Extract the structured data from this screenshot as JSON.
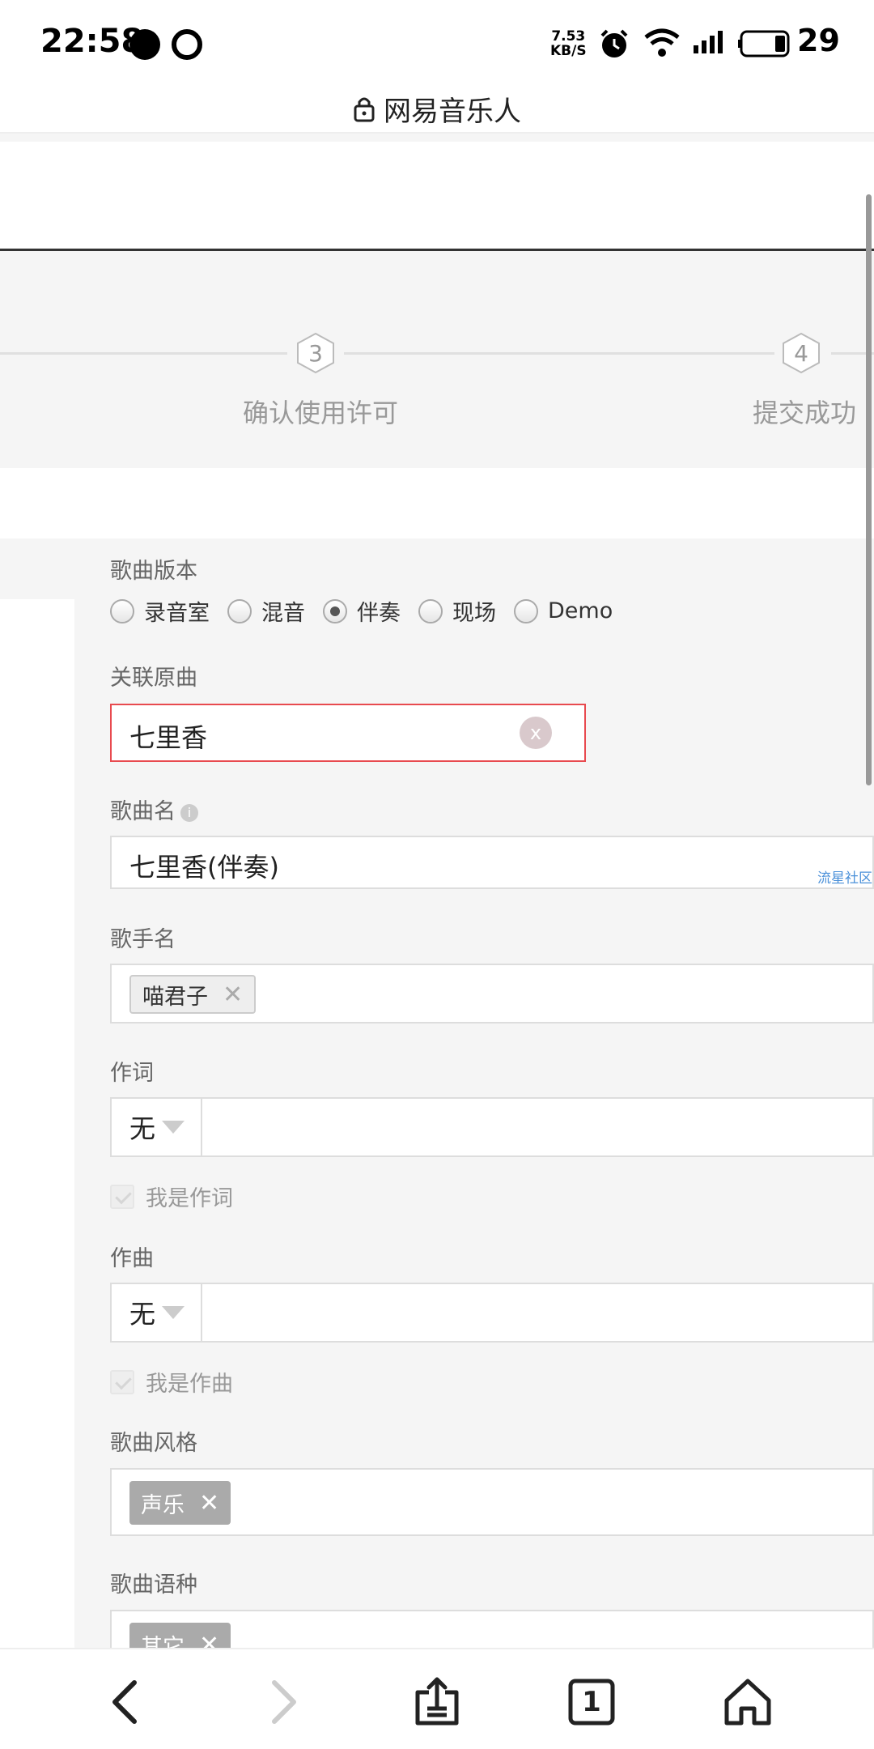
{
  "status_bar": {
    "time": "22:58",
    "net_speed_value": "7.53",
    "net_speed_unit": "KB/S",
    "battery": "29",
    "icons": [
      "chat-bubble-icon",
      "hot-icon",
      "alarm-icon",
      "wifi-icon",
      "signal-icon",
      "battery-icon"
    ]
  },
  "url_bar": {
    "title": "网易音乐人",
    "icon": "lock-icon"
  },
  "steps": [
    {
      "number": "3",
      "label": "确认使用许可"
    },
    {
      "number": "4",
      "label": "提交成功"
    }
  ],
  "form": {
    "version": {
      "label": "歌曲版本",
      "options": [
        "录音室",
        "混音",
        "伴奏",
        "现场",
        "Demo"
      ],
      "selected": "伴奏"
    },
    "original_song": {
      "label": "关联原曲",
      "value": "七里香",
      "clear_label": "x"
    },
    "song_name": {
      "label": "歌曲名",
      "info_glyph": "i",
      "value": "七里香(伴奏)",
      "side_link": "流星社区"
    },
    "singer": {
      "label": "歌手名",
      "tags": [
        "喵君子"
      ]
    },
    "lyricist": {
      "label": "作词",
      "select_value": "无",
      "check_label": "我是作词"
    },
    "composer": {
      "label": "作曲",
      "select_value": "无",
      "check_label": "我是作曲"
    },
    "style": {
      "label": "歌曲风格",
      "tags": [
        "声乐"
      ]
    },
    "language": {
      "label": "歌曲语种",
      "tags": [
        "其它"
      ]
    }
  },
  "bottom_nav": {
    "items": [
      "back-icon",
      "forward-icon",
      "share-icon",
      "tabs-icon",
      "home-icon"
    ],
    "tab_count": "1"
  },
  "colors": {
    "accent_error_border": "#e84a4f",
    "page_bg": "#f5f5f5",
    "tag_dark": "#aaaaaa"
  }
}
